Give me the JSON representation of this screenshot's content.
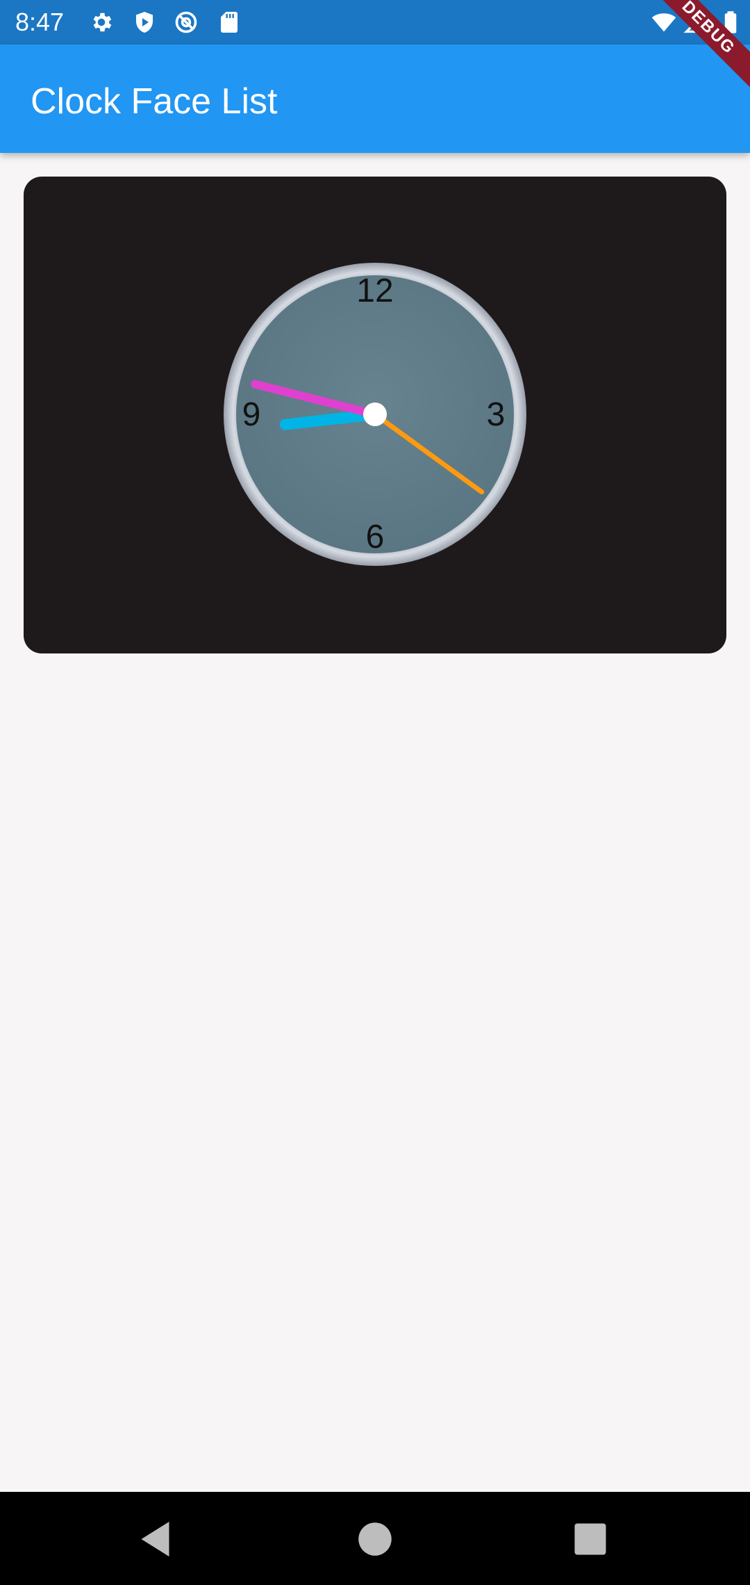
{
  "status_bar": {
    "time": "8:47",
    "icons": [
      "settings-icon",
      "shield-icon",
      "at-sign-icon",
      "sd-card-icon",
      "wifi-icon",
      "signal-icon",
      "battery-icon"
    ]
  },
  "app_bar": {
    "title": "Clock Face List",
    "debug_label": "DEBUG"
  },
  "clock": {
    "numbers": {
      "twelve": "12",
      "three": "3",
      "six": "6",
      "nine": "9"
    },
    "time": {
      "hours": 8,
      "minutes": 47,
      "seconds": 21
    },
    "colors": {
      "card_background": "#1e1a1b",
      "face": "#607d8b",
      "rim": "#cfd6e0",
      "hour_hand": "#00b4e6",
      "minute_hand": "#e040d0",
      "second_hand": "#ff9a10",
      "center_dot": "#ffffff",
      "numerals": "#111111"
    }
  },
  "nav_bar": {
    "buttons": [
      "back-icon",
      "home-icon",
      "recents-icon"
    ]
  }
}
